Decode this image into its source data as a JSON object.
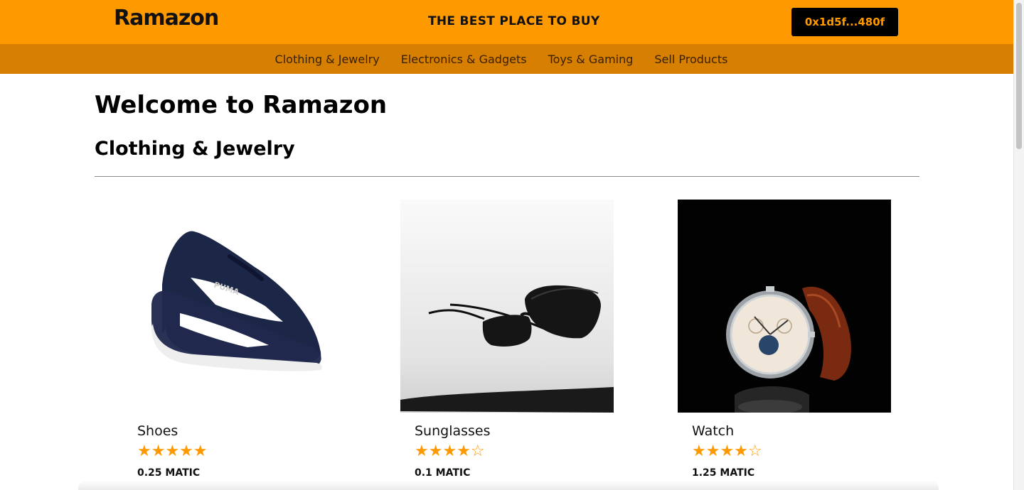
{
  "header": {
    "logo": "Ramazon",
    "tagline": "THE BEST PLACE TO BUY",
    "wallet_address": "0x1d5f...480f"
  },
  "nav": {
    "links": [
      "Clothing & Jewelry",
      "Electronics & Gadgets",
      "Toys & Gaming",
      "Sell Products"
    ]
  },
  "main": {
    "welcome": "Welcome to Ramazon",
    "section_title": "Clothing & Jewelry",
    "products": [
      {
        "name": "Shoes",
        "rating": 5,
        "max_rating": 5,
        "price": "0.25 MATIC",
        "stars": "★★★★★"
      },
      {
        "name": "Sunglasses",
        "rating": 4,
        "max_rating": 5,
        "price": "0.1 MATIC",
        "stars": "★★★★☆"
      },
      {
        "name": "Watch",
        "rating": 4,
        "max_rating": 5,
        "price": "1.25 MATIC",
        "stars": "★★★★☆"
      }
    ]
  },
  "colors": {
    "header_bg": "#ff9900",
    "nav_bg": "#d67f00",
    "wallet_bg": "#000000",
    "accent": "#ff9900"
  },
  "icons": {
    "rating": "star-icon"
  }
}
